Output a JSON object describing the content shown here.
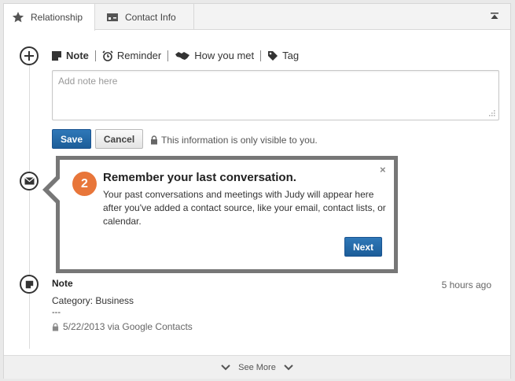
{
  "tabs": {
    "relationship": "Relationship",
    "contact_info": "Contact Info"
  },
  "actions": {
    "note": "Note",
    "reminder": "Reminder",
    "how_you_met": "How you met",
    "tag": "Tag"
  },
  "note_input": {
    "placeholder": "Add note here",
    "value": ""
  },
  "buttons": {
    "save": "Save",
    "cancel": "Cancel"
  },
  "privacy_text": "This information is only visible to you.",
  "callout": {
    "step": "2",
    "title": "Remember your last conversation.",
    "body": "Your past conversations and meetings with Judy will appear here after you've added a contact source, like your email, contact lists, or calendar.",
    "close": "×",
    "next": "Next"
  },
  "note_entry": {
    "title": "Note",
    "time": "5 hours ago",
    "category": "Category: Business",
    "dash": "---",
    "source": "5/22/2013 via Google Contacts"
  },
  "footer": {
    "see_more": "See More"
  },
  "colors": {
    "primary_button": "#1c5d99",
    "badge": "#e8763a",
    "callout_border": "#777777"
  }
}
